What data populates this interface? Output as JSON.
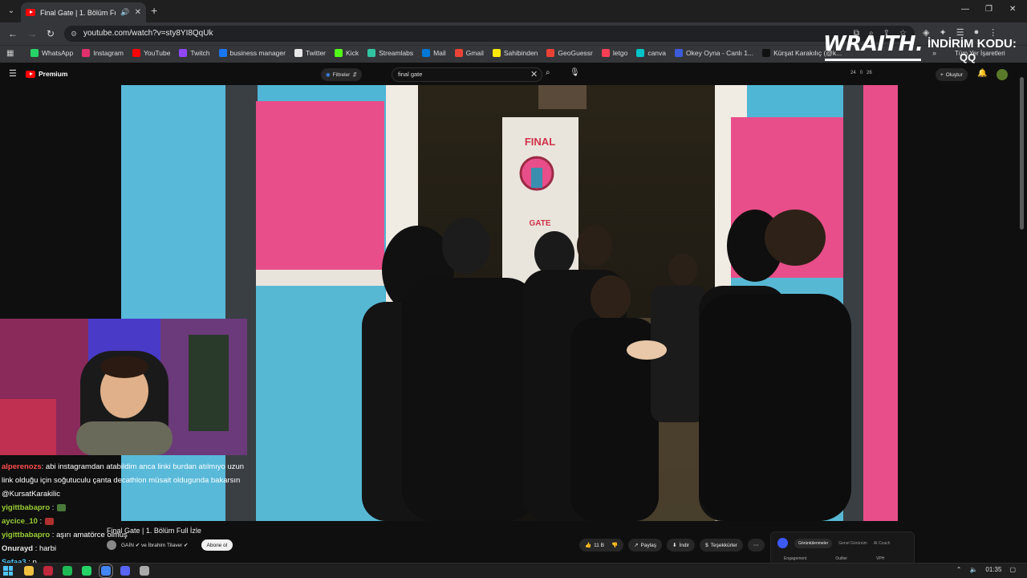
{
  "browser": {
    "tab": {
      "title": "Final Gate | 1. Bölüm Full İzle",
      "icon": "youtube-icon"
    },
    "url": "youtube.com/watch?v=sty8YI8QqUk",
    "window_controls": [
      "minimize",
      "restore",
      "close"
    ]
  },
  "bookmarks": {
    "items": [
      {
        "label": "WhatsApp",
        "color": "#25d366"
      },
      {
        "label": "Instagram",
        "color": "#e1306c"
      },
      {
        "label": "YouTube",
        "color": "#ff0000"
      },
      {
        "label": "Twitch",
        "color": "#9146ff"
      },
      {
        "label": "business manager",
        "color": "#1877f2"
      },
      {
        "label": "Twitter",
        "color": "#e7e7e7"
      },
      {
        "label": "Kick",
        "color": "#53fc18"
      },
      {
        "label": "Streamlabs",
        "color": "#31c3a2"
      },
      {
        "label": "Mail",
        "color": "#0078d4"
      },
      {
        "label": "Gmail",
        "color": "#ea4335"
      },
      {
        "label": "Sahibinden",
        "color": "#ffe800"
      },
      {
        "label": "GeoGuessr",
        "color": "#e94235"
      },
      {
        "label": "letgo",
        "color": "#ff3f55"
      },
      {
        "label": "canva",
        "color": "#00c4cc"
      },
      {
        "label": "Okey Oyna - Canlı 1...",
        "color": "#3b5bdb"
      },
      {
        "label": "Kürşat Karakılıç (@k...",
        "color": "#111111"
      }
    ],
    "all_bookmarks": "Tüm Yer İşaretleri"
  },
  "overlay": {
    "brand": "WRAITH.",
    "code_label": "İNDİRİM KODU:",
    "code": "QQ"
  },
  "youtube": {
    "logo_label": "Premium",
    "filter_label": "Filtreler",
    "search_query": "final gate",
    "stats": [
      "24",
      "0",
      "26"
    ],
    "create_label": "Oluştur",
    "video_title": "Final Gate | 1. Bölüm Full İzle",
    "channel": "GAİN ✔ ve İbrahim Tilaver ✔",
    "subscribe_label": "Abone ol",
    "like_count": "11 B",
    "share_label": "Paylaş",
    "download_label": "İndir",
    "thanks_label": "Teşekkürler",
    "gate_sign_top": "FINAL",
    "gate_sign_bottom": "GATE"
  },
  "vidiq": {
    "tabs": [
      "Görüntülenmeler",
      "Genel Görünüm",
      "AI Coach"
    ],
    "metrics": [
      "Engagement",
      "Outlier",
      "VPH"
    ]
  },
  "chat": {
    "messages": [
      {
        "user": "alperenozs",
        "text": ": abi instagramdan atabildim anca linki burdan atılmıyo uzun link olduğu için soğutuculu çanta decathlon müsait oldugunda bakarsın @KursatKarakilic",
        "color": "#ff4d4d"
      },
      {
        "user": "yigittbabapro",
        "text": " :",
        "color": "#9acd32",
        "emote": "#4a7a3a"
      },
      {
        "user": "aycice_10",
        "text": " :",
        "color": "#9acd32",
        "emote": "#b03030"
      },
      {
        "user": "yigittbabapro",
        "text": " : aşırı amatörce olmuş",
        "color": "#9acd32"
      },
      {
        "user": "Onurayd",
        "text": " : harbi",
        "color": "#e8e8e8"
      },
      {
        "user": "Sefaa3",
        "text": " : p",
        "color": "#4fc3f7"
      }
    ]
  },
  "taskbar": {
    "clock": "01:35",
    "apps": [
      {
        "name": "file-explorer",
        "color": "#f0c040"
      },
      {
        "name": "app-red",
        "color": "#c0283c"
      },
      {
        "name": "spotify",
        "color": "#1db954"
      },
      {
        "name": "whatsapp",
        "color": "#25d366"
      },
      {
        "name": "chrome",
        "color": "#4285f4"
      },
      {
        "name": "discord",
        "color": "#5865f2"
      },
      {
        "name": "settings",
        "color": "#aaaaaa"
      }
    ]
  }
}
